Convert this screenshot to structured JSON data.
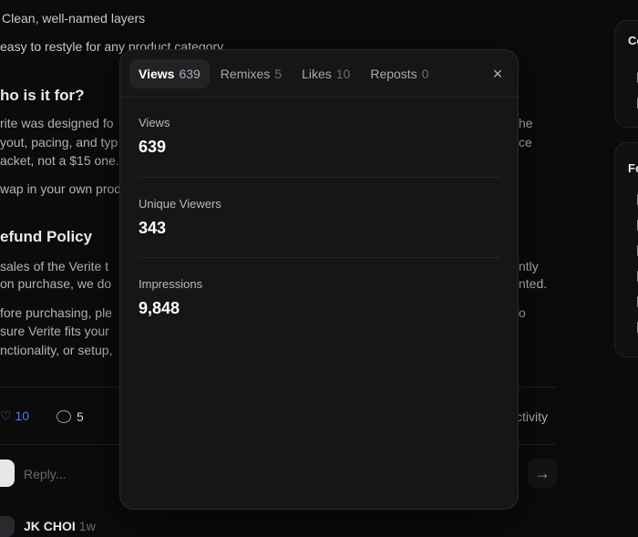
{
  "background": {
    "lines": [
      {
        "id": "feature-2",
        "text": "Clean, well-named layers"
      },
      {
        "id": "feature-3",
        "text": "easy to restyle for any product category"
      },
      {
        "id": "who-heading",
        "text": "ho is it for?"
      },
      {
        "id": "who-p1-a",
        "text": "rite was designed fo"
      },
      {
        "id": "who-p1-b",
        "text": "yout, pacing, and typ"
      },
      {
        "id": "who-p1-c",
        "text": "acket, not a $15 one."
      },
      {
        "id": "who-p2",
        "text": "wap in your own prod"
      },
      {
        "id": "refund-heading",
        "text": "efund Policy"
      },
      {
        "id": "refund-p1-a",
        "text": "sales of the Verite t"
      },
      {
        "id": "refund-p1-b",
        "text": "on purchase, we do"
      },
      {
        "id": "refund-p2-a",
        "text": "fore purchasing, ple"
      },
      {
        "id": "refund-p2-b",
        "text": "sure Verite fits your"
      },
      {
        "id": "refund-p2-c",
        "text": "nctionality, or setup,"
      },
      {
        "id": "right-1",
        "text": "he"
      },
      {
        "id": "right-2",
        "text": "ce"
      },
      {
        "id": "right-3",
        "text": "ntly"
      },
      {
        "id": "right-4",
        "text": "nted."
      },
      {
        "id": "right-5",
        "text": "o"
      }
    ],
    "likes_count": "10",
    "comments_count": "5",
    "activity_label": "ctivity",
    "reply_placeholder": "Reply...",
    "comment_author": "JK CHOI",
    "comment_time": "1w",
    "side_card_1_title": "Co",
    "side_card_2_title": "Fe"
  },
  "modal": {
    "tabs": [
      {
        "label": "Views",
        "count": "639"
      },
      {
        "label": "Remixes",
        "count": "5"
      },
      {
        "label": "Likes",
        "count": "10"
      },
      {
        "label": "Reposts",
        "count": "0"
      }
    ],
    "close_glyph": "×",
    "stats": [
      {
        "label": "Views",
        "value": "639"
      },
      {
        "label": "Unique Viewers",
        "value": "343"
      },
      {
        "label": "Impressions",
        "value": "9,848"
      }
    ]
  },
  "colors": {
    "background": "#0b0b0c",
    "modal": "#161618",
    "accent_blue": "#3b82f6"
  }
}
